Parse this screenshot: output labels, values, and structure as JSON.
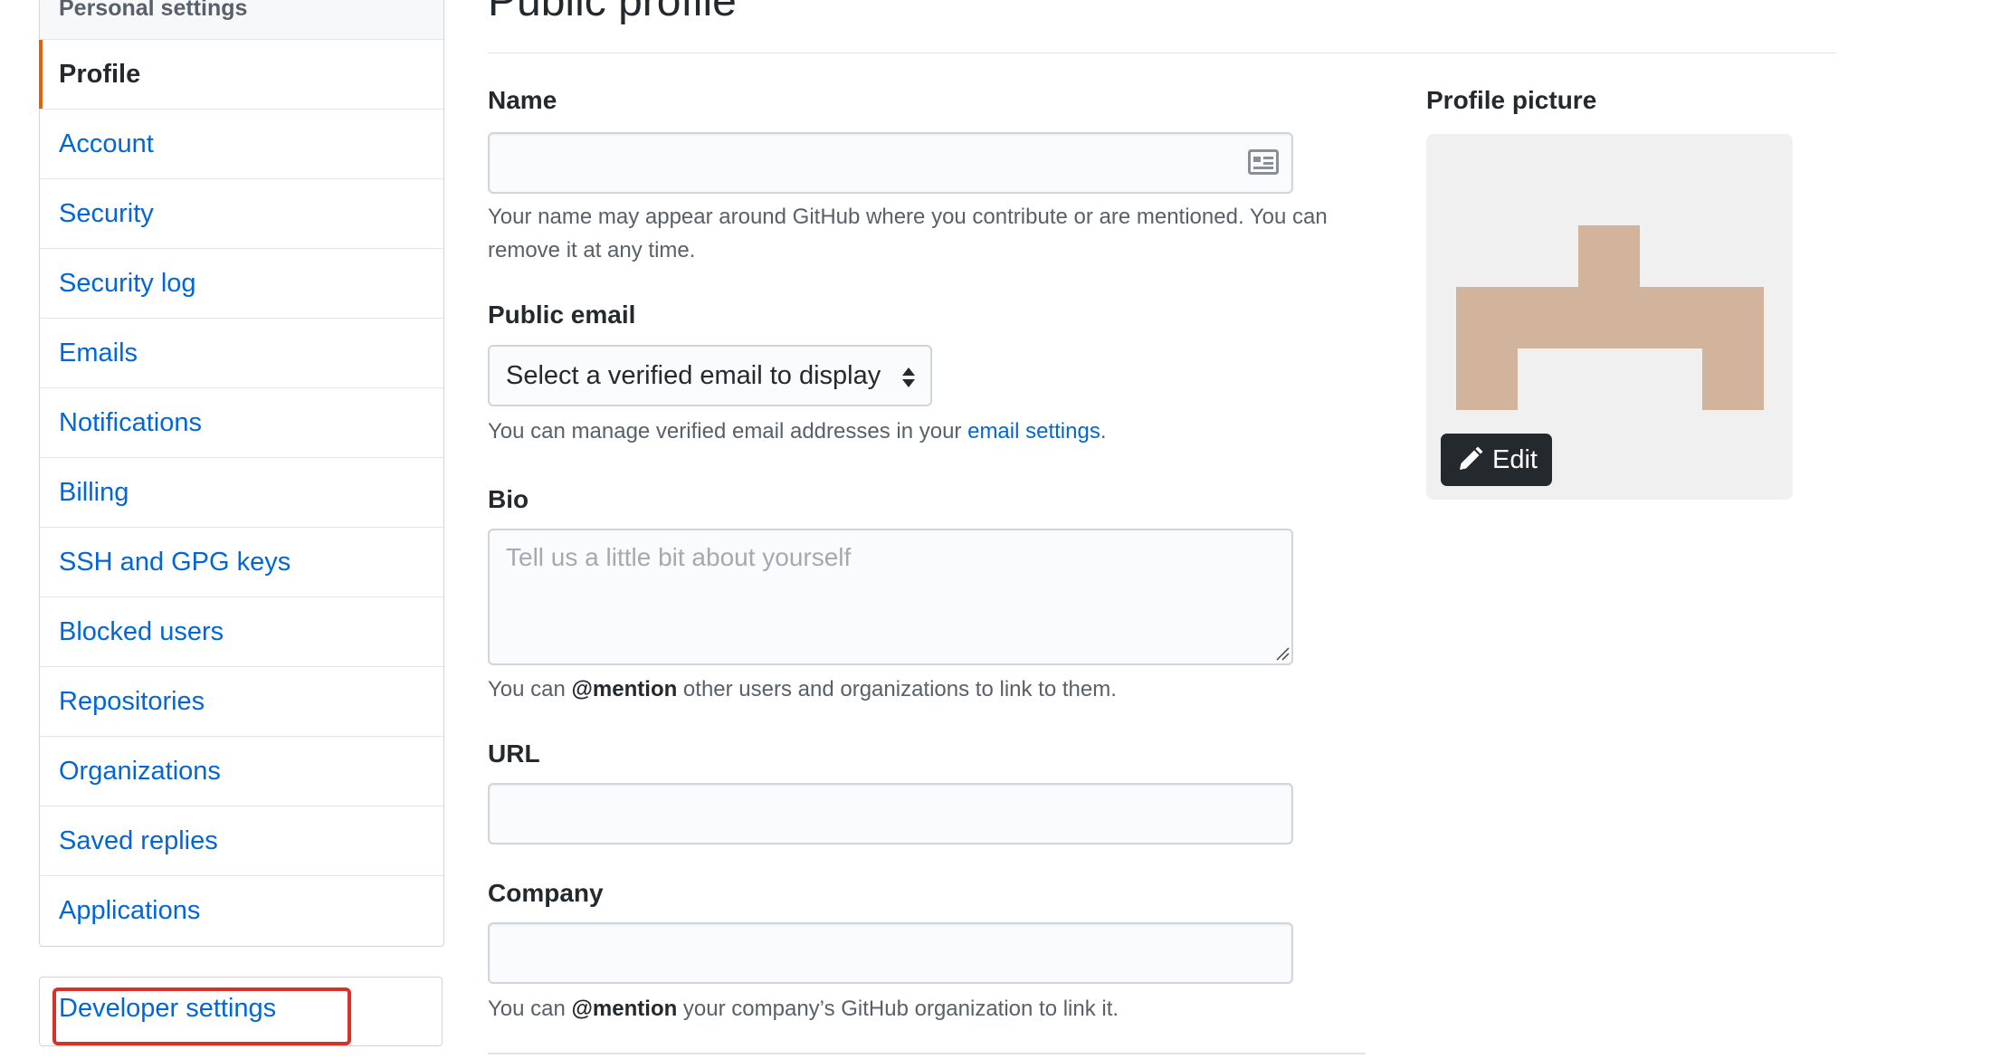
{
  "sidebar": {
    "header": "Personal settings",
    "items": [
      {
        "label": "Profile",
        "selected": true
      },
      {
        "label": "Account"
      },
      {
        "label": "Security"
      },
      {
        "label": "Security log"
      },
      {
        "label": "Emails"
      },
      {
        "label": "Notifications"
      },
      {
        "label": "Billing"
      },
      {
        "label": "SSH and GPG keys"
      },
      {
        "label": "Blocked users"
      },
      {
        "label": "Repositories"
      },
      {
        "label": "Organizations"
      },
      {
        "label": "Saved replies"
      },
      {
        "label": "Applications"
      }
    ],
    "developer_settings": "Developer settings"
  },
  "main": {
    "title": "Public profile",
    "name": {
      "label": "Name",
      "value": "",
      "note": "Your name may appear around GitHub where you contribute or are mentioned. You can remove it at any time."
    },
    "public_email": {
      "label": "Public email",
      "selected": "Select a verified email to display",
      "note_prefix": "You can manage verified email addresses in your ",
      "note_link": "email settings",
      "note_suffix": "."
    },
    "bio": {
      "label": "Bio",
      "placeholder": "Tell us a little bit about yourself",
      "note_prefix": "You can ",
      "note_bold": "@mention",
      "note_suffix": " other users and organizations to link to them."
    },
    "url": {
      "label": "URL",
      "value": ""
    },
    "company": {
      "label": "Company",
      "value": "",
      "note_prefix": "You can ",
      "note_bold": "@mention",
      "note_suffix": " your company’s GitHub organization to link it."
    }
  },
  "profile_picture": {
    "label": "Profile picture",
    "edit_label": "Edit",
    "avatar_color": "#d2b49c",
    "avatar_bg": "#f0f0f0"
  },
  "colors": {
    "link": "#0366d6",
    "selected_indicator": "#e36209",
    "highlight": "#d9302a",
    "edit_button_bg": "#24292e"
  }
}
